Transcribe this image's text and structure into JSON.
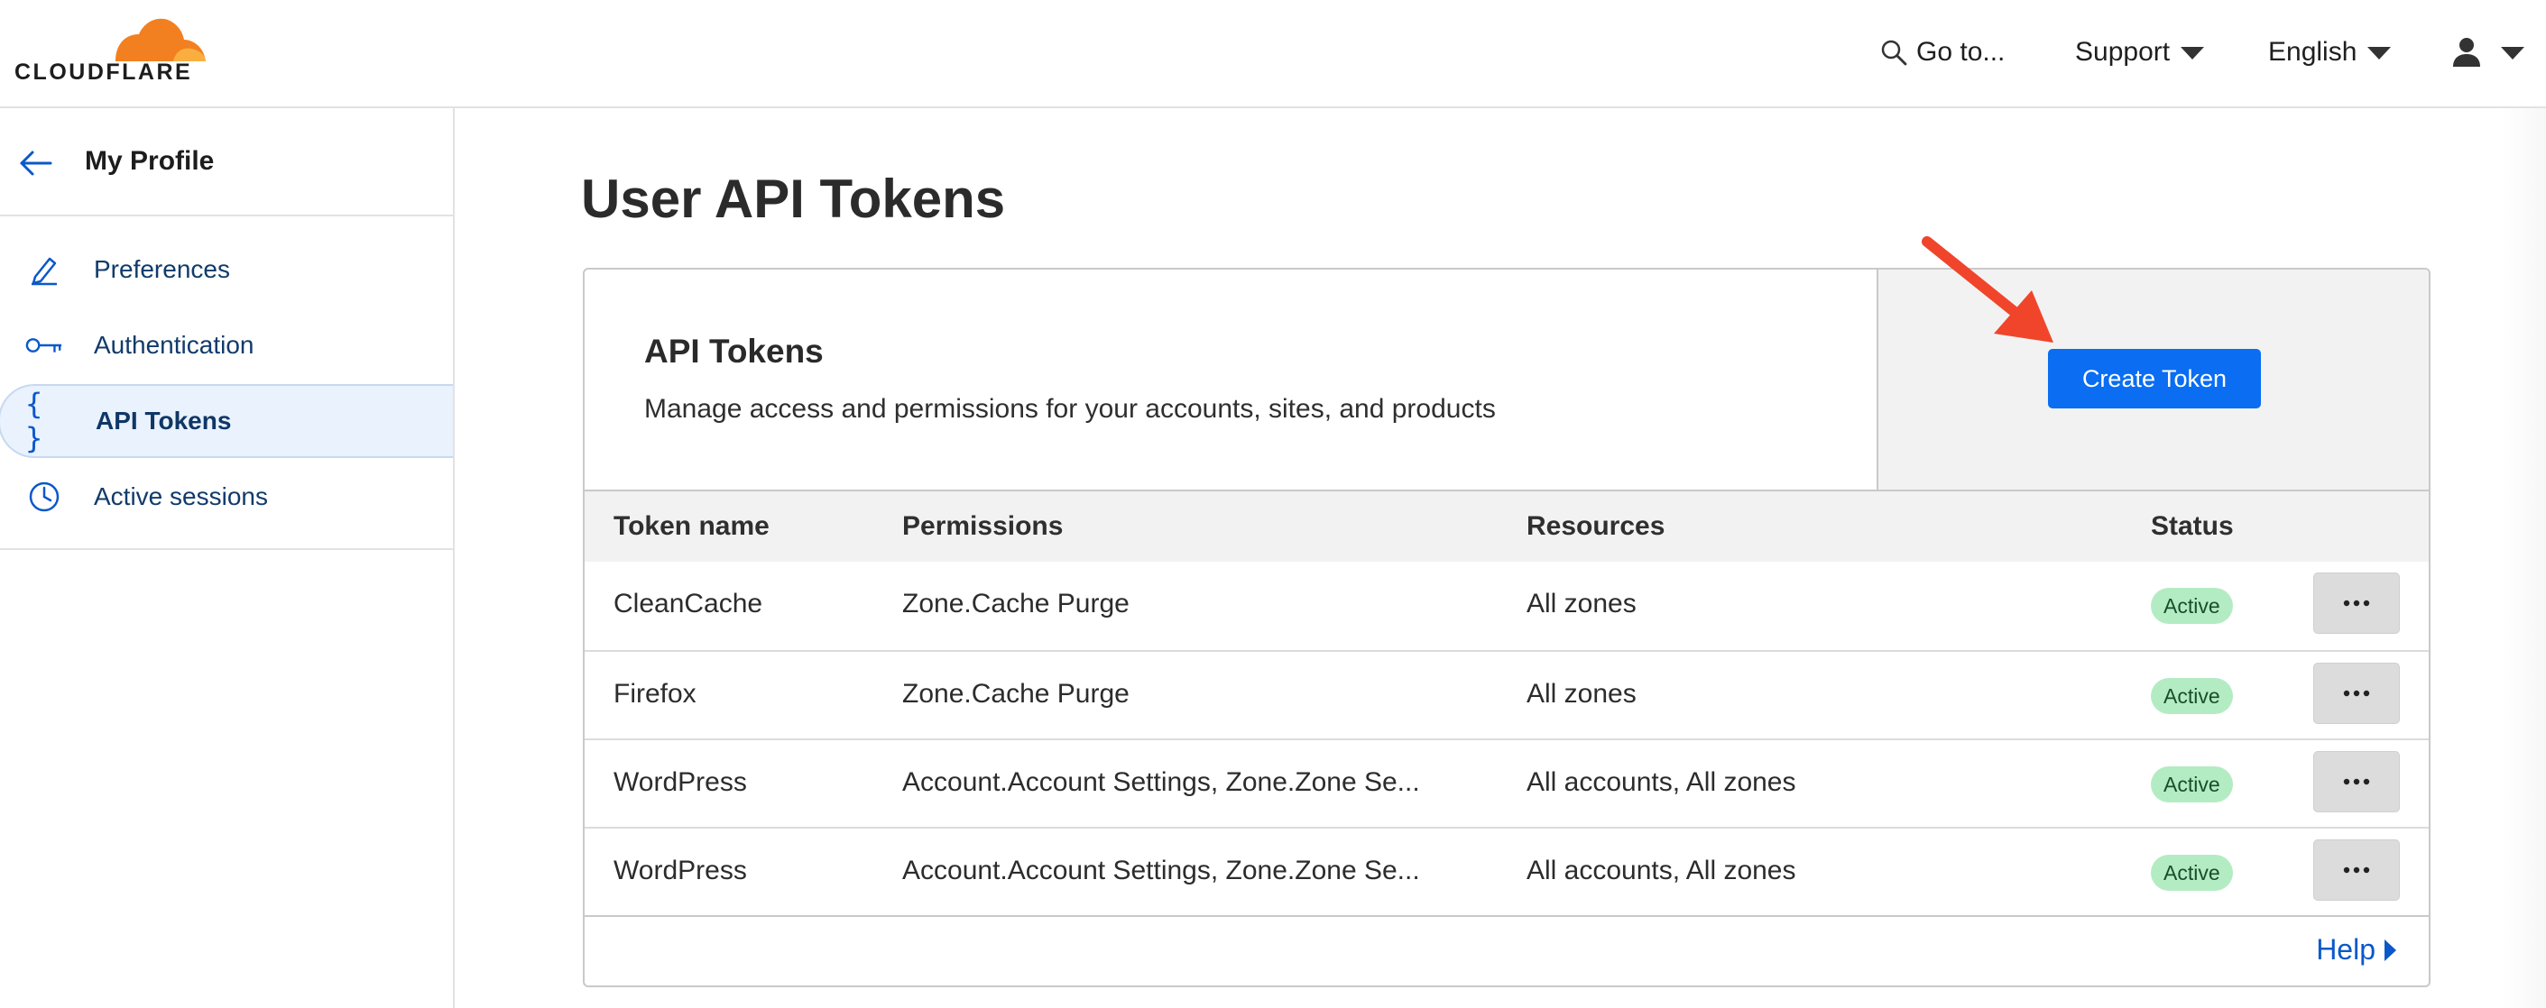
{
  "brand": {
    "logo_text": "CLOUDFLARE",
    "accent_color": "#f38020"
  },
  "topnav": {
    "goto_label": "Go to...",
    "support_label": "Support",
    "language_label": "English"
  },
  "sidebar": {
    "title": "My Profile",
    "items": [
      {
        "label": "Preferences",
        "icon": "pencil-icon"
      },
      {
        "label": "Authentication",
        "icon": "key-icon"
      },
      {
        "label": "API Tokens",
        "icon": "braces-icon",
        "active": true
      },
      {
        "label": "Active sessions",
        "icon": "clock-icon"
      }
    ]
  },
  "main": {
    "page_title": "User API Tokens",
    "card": {
      "title": "API Tokens",
      "description": "Manage access and permissions for your accounts, sites, and products",
      "create_button": "Create Token",
      "columns": [
        "Token name",
        "Permissions",
        "Resources",
        "Status"
      ],
      "rows": [
        {
          "name": "CleanCache",
          "permissions": "Zone.Cache Purge",
          "resources": "All zones",
          "status": "Active"
        },
        {
          "name": "Firefox",
          "permissions": "Zone.Cache Purge",
          "resources": "All zones",
          "status": "Active"
        },
        {
          "name": "WordPress",
          "permissions": "Account.Account Settings, Zone.Zone Se...",
          "resources": "All accounts, All zones",
          "status": "Active"
        },
        {
          "name": "WordPress",
          "permissions": "Account.Account Settings, Zone.Zone Se...",
          "resources": "All accounts, All zones",
          "status": "Active"
        }
      ],
      "help_label": "Help"
    }
  },
  "colors": {
    "primary_button": "#0a6df2",
    "status_active_bg": "#b3ecc3",
    "annotation_arrow": "#f0452b"
  }
}
